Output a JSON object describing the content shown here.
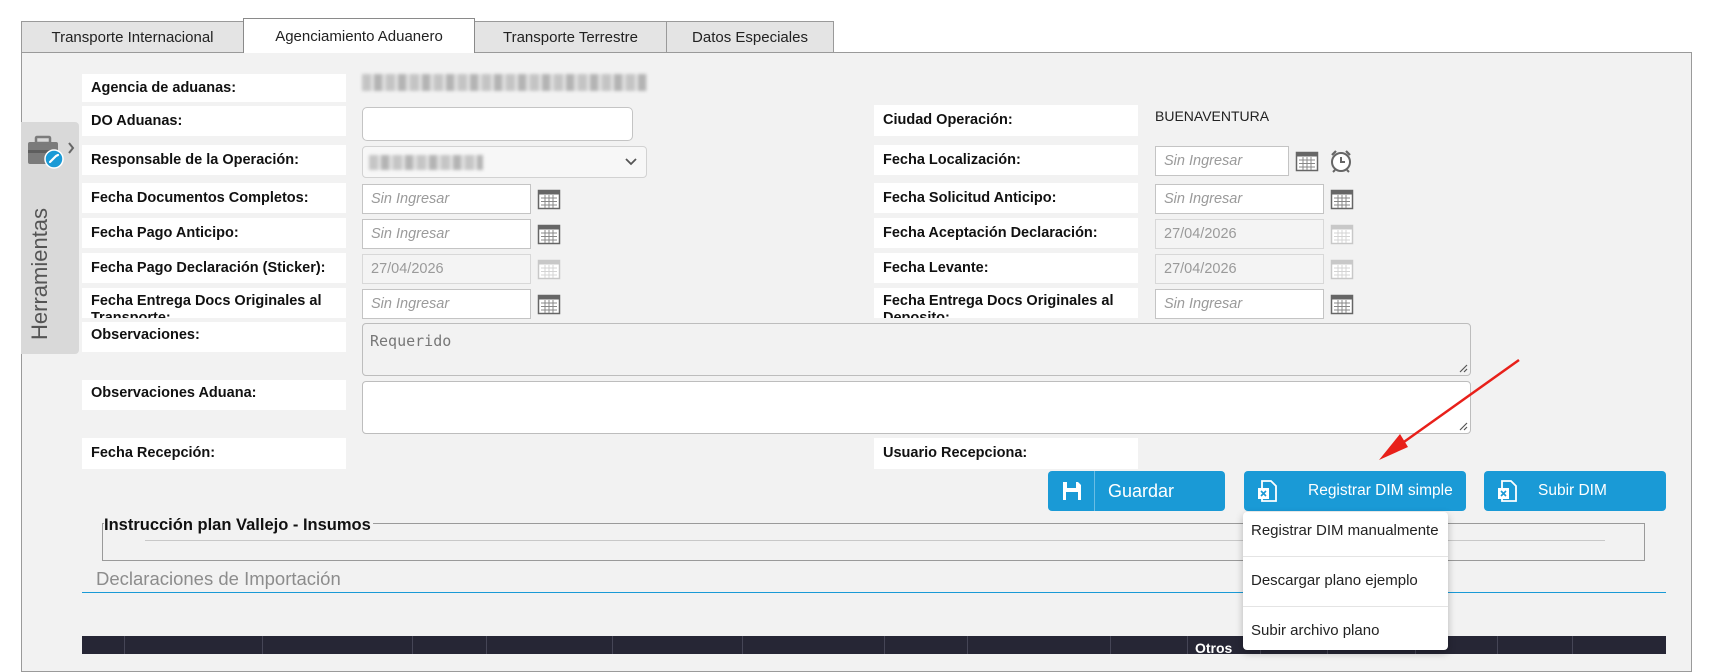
{
  "tabs": [
    "Transporte Internacional",
    "Agenciamiento Aduanero",
    "Transporte Terrestre",
    "Datos Especiales"
  ],
  "tools": {
    "label": "Herramientas",
    "icon": "toolbox-icon"
  },
  "form": {
    "agencia_label": "Agencia de aduanas:",
    "do_label": "DO Aduanas:",
    "responsable_label": "Responsable de la Operación:",
    "fecha_docs_label": "Fecha Documentos Completos:",
    "fecha_docs_placeholder": "Sin Ingresar",
    "fecha_pago_label": "Fecha Pago Anticipo:",
    "fecha_pago_placeholder": "Sin Ingresar",
    "fecha_pago_decl_label": "Fecha Pago Declaración (Sticker):",
    "fecha_pago_decl_value": "27/04/2026",
    "fecha_entrega_transp_label": "Fecha Entrega Docs Originales al Transporte:",
    "fecha_entrega_transp_placeholder": "Sin Ingresar",
    "observaciones_label": "Observaciones:",
    "observaciones_placeholder": "Requerido",
    "obs_aduana_label": "Observaciones Aduana:",
    "fecha_recepcion_label": "Fecha Recepción:",
    "ciudad_label": "Ciudad Operación:",
    "ciudad_value": "BUENAVENTURA",
    "fecha_localizacion_label": "Fecha Localización:",
    "fecha_localizacion_placeholder": "Sin Ingresar",
    "fecha_sol_anticipo_label": "Fecha Solicitud Anticipo:",
    "fecha_sol_anticipo_placeholder": "Sin Ingresar",
    "fecha_aceptacion_label": "Fecha Aceptación Declaración:",
    "fecha_aceptacion_value": "27/04/2026",
    "fecha_levante_label": "Fecha Levante:",
    "fecha_levante_value": "27/04/2026",
    "fecha_entrega_dep_label": "Fecha Entrega Docs Originales al Deposito:",
    "fecha_entrega_dep_placeholder": "Sin Ingresar",
    "usuario_recepciona_label": "Usuario Recepciona:"
  },
  "buttons": {
    "guardar": "Guardar",
    "registrar_dim": "Registrar DIM simple",
    "subir_dim": "Subir DIM"
  },
  "dropdown": [
    "Registrar DIM manualmente",
    "Descargar plano ejemplo",
    "Subir archivo plano"
  ],
  "instruccion_legend": "Instrucción plan Vallejo - Insumos",
  "section_title": "Declaraciones de Importación",
  "table": {
    "visible_header": "Otros"
  },
  "colors": {
    "accent": "#1a9ad6",
    "table_header": "#262635",
    "arrow": "#e8201a"
  }
}
